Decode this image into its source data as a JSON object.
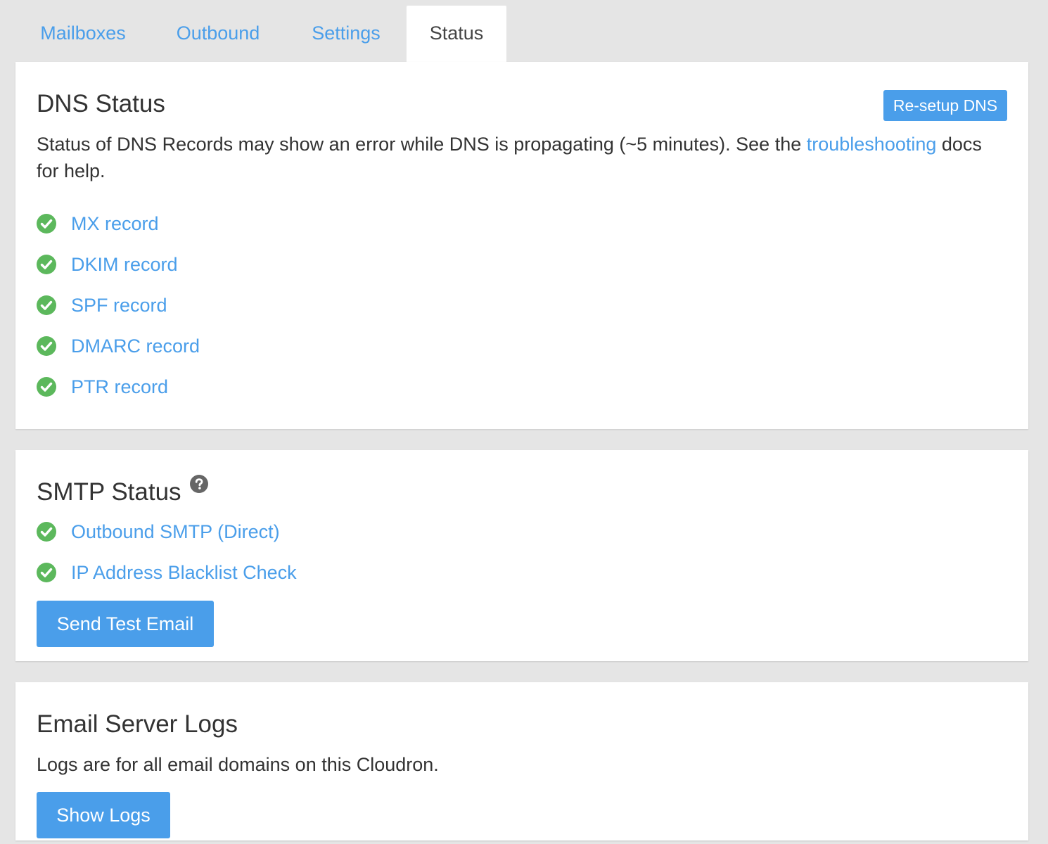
{
  "tabs": [
    {
      "label": "Mailboxes"
    },
    {
      "label": "Outbound"
    },
    {
      "label": "Settings"
    },
    {
      "label": "Status"
    }
  ],
  "colors": {
    "accent": "#4a9eea",
    "success": "#5cb85c",
    "background": "#e5e5e5",
    "card": "#ffffff"
  },
  "dns": {
    "title": "DNS Status",
    "resetup_button": "Re-setup DNS",
    "description": "Status of DNS Records may show an error while DNS is propagating (~5 minutes). See the ",
    "link": "troubleshooting",
    "description_end": " docs for help.",
    "records": [
      {
        "label": "MX record",
        "status": "ok",
        "icon": "check-circle-icon"
      },
      {
        "label": "DKIM record",
        "status": "ok",
        "icon": "check-circle-icon"
      },
      {
        "label": "SPF record",
        "status": "ok",
        "icon": "check-circle-icon"
      },
      {
        "label": "DMARC record",
        "status": "ok",
        "icon": "check-circle-icon"
      },
      {
        "label": "PTR record",
        "status": "ok",
        "icon": "check-circle-icon"
      }
    ]
  },
  "smtp": {
    "title": "SMTP Status",
    "help_icon": "question-circle-icon",
    "checks": [
      {
        "label": "Outbound SMTP (Direct)",
        "status": "ok",
        "icon": "check-circle-icon"
      },
      {
        "label": "IP Address Blacklist Check",
        "status": "ok",
        "icon": "check-circle-icon"
      }
    ],
    "test_button": "Send Test Email"
  },
  "logs": {
    "title": "Email Server Logs",
    "description": "Logs are for all email domains on this Cloudron.",
    "button": "Show Logs"
  }
}
